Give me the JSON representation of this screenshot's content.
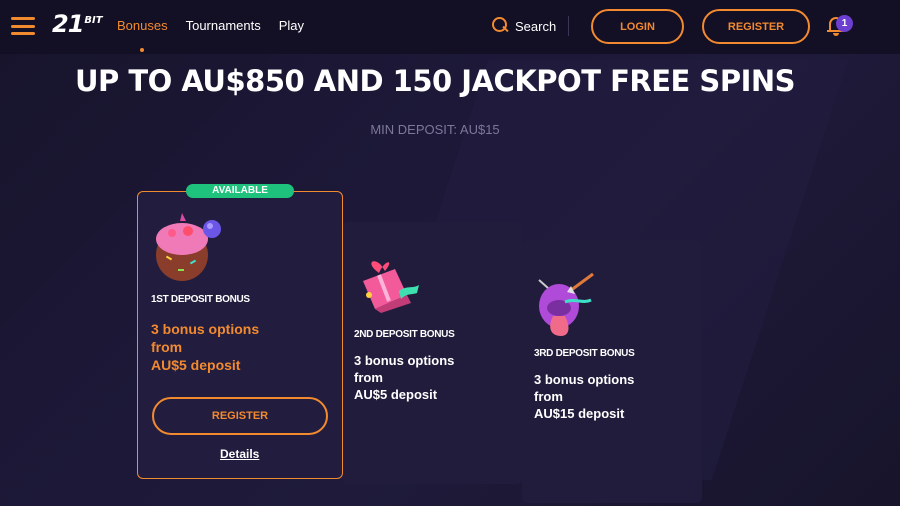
{
  "header": {
    "logo_num": "21",
    "logo_word": "BIT",
    "nav": [
      {
        "label": "Bonuses",
        "active": true
      },
      {
        "label": "Tournaments",
        "active": false
      },
      {
        "label": "Play",
        "active": false
      }
    ],
    "search_label": "Search",
    "login_label": "LOGIN",
    "register_label": "REGISTER",
    "notification_count": "1"
  },
  "hero": {
    "title": "UP TO AU$850 AND 150 JACKPOT FREE SPINS",
    "min_deposit": "MIN DEPOSIT: AU$15"
  },
  "cards": [
    {
      "badge": "AVAILABLE",
      "title": "1ST DEPOSIT BONUS",
      "offer_line1": "3 bonus options",
      "offer_line2": "from",
      "offer_line3": "AU$5 deposit",
      "register_label": "REGISTER",
      "details_label": "Details",
      "icon": "candy-ball-icon"
    },
    {
      "title": "2ND DEPOSIT BONUS",
      "offer_line1": "3 bonus options",
      "offer_line2": "from",
      "offer_line3": "AU$5 deposit",
      "icon": "gift-box-icon"
    },
    {
      "title": "3RD DEPOSIT BONUS",
      "offer_line1": "3 bonus options",
      "offer_line2": "from",
      "offer_line3": "AU$15 deposit",
      "icon": "mushroom-icon"
    }
  ],
  "colors": {
    "accent": "#f28a30",
    "available": "#1fc27c",
    "badge": "#6c3fd1",
    "background": "#1a1630"
  }
}
